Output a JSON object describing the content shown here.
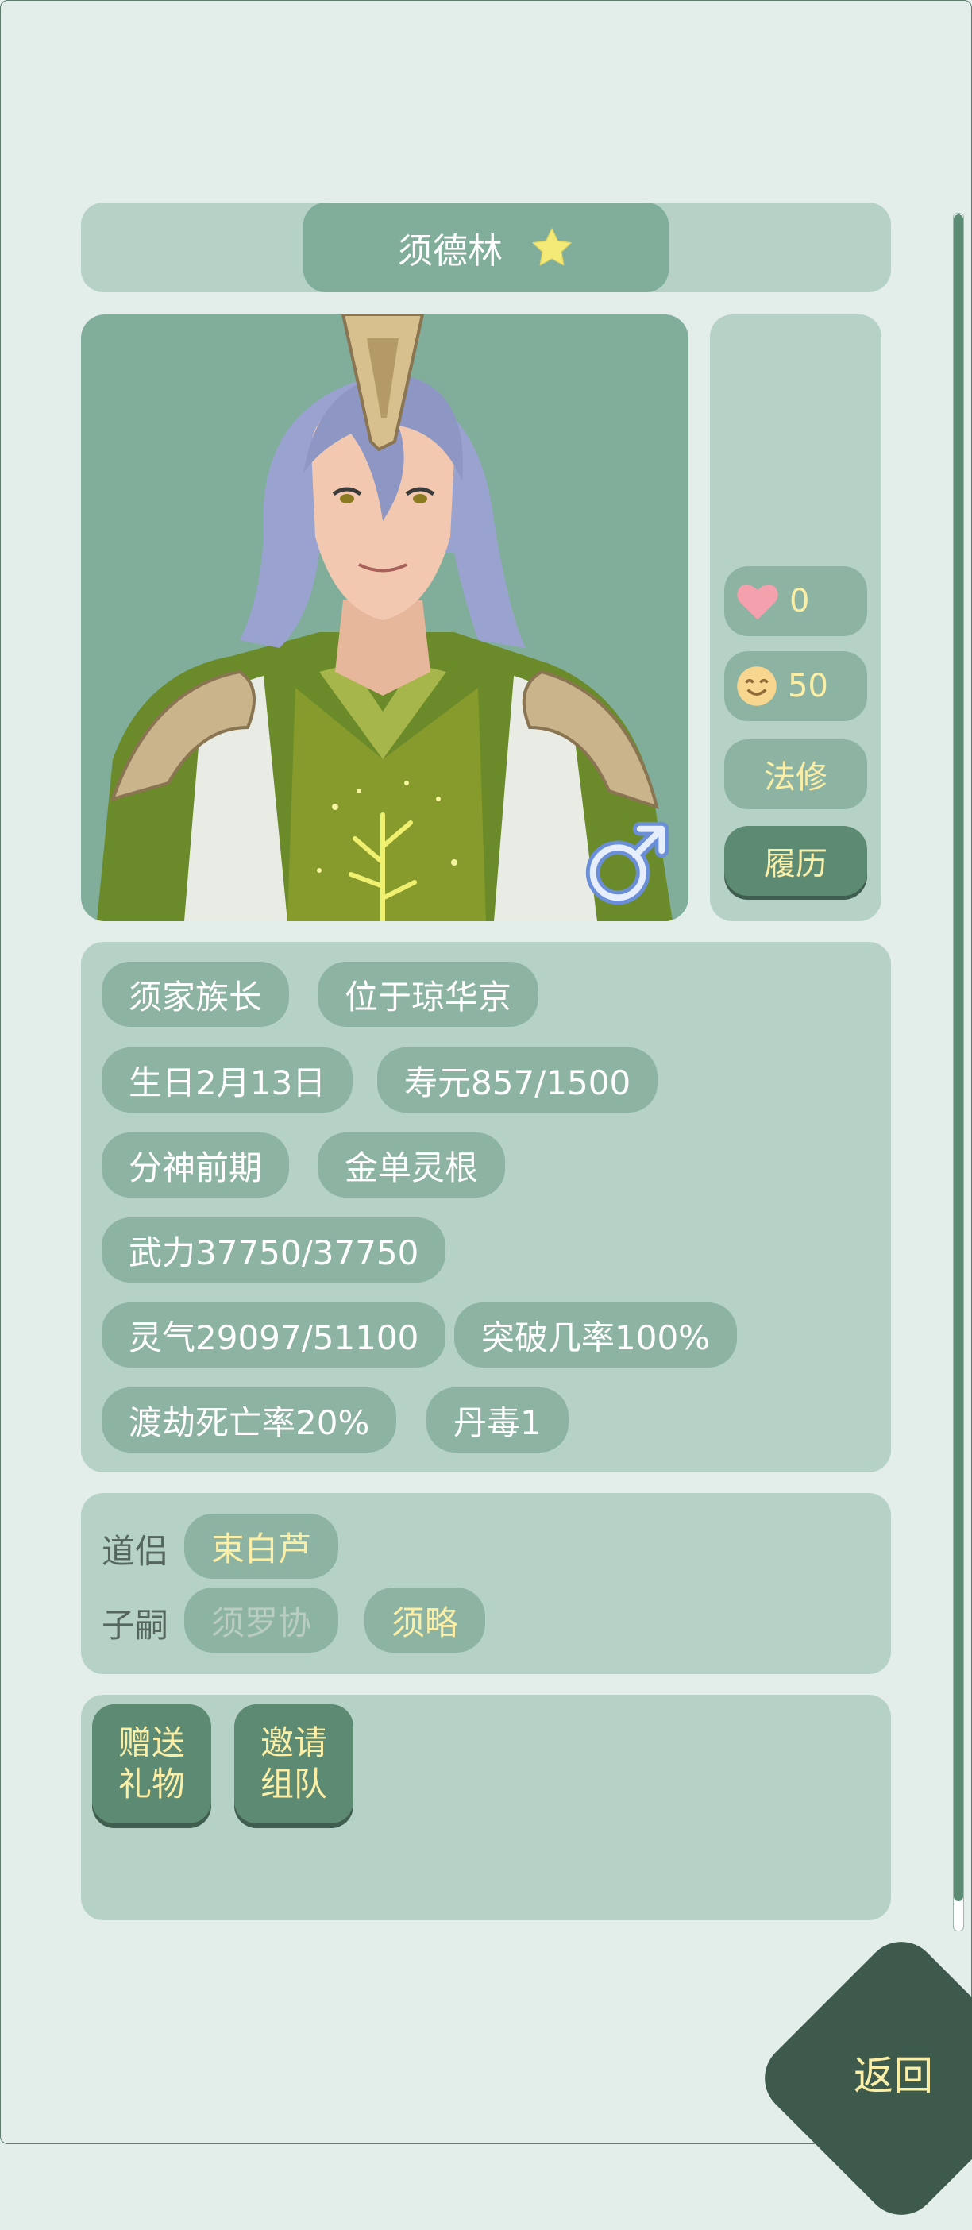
{
  "character": {
    "name": "须德林",
    "favorite_icon": "star-icon",
    "gender_icon": "male-icon"
  },
  "side": {
    "affection": "0",
    "mood": "50",
    "path_label": "法修",
    "history_label": "履历"
  },
  "info_tags": [
    "须家族长",
    "位于琼华京",
    "生日2月13日",
    "寿元857/1500",
    "分神前期",
    "金单灵根",
    "武力37750/37750",
    "灵气29097/51100",
    "突破几率100%",
    "渡劫死亡率20%",
    "丹毒1"
  ],
  "relations": {
    "partner_label": "道侣",
    "partner": "束白芦",
    "children_label": "子嗣",
    "children": [
      "须罗协",
      "须略"
    ]
  },
  "actions": {
    "gift_label": "赠送\n礼物",
    "invite_label": "邀请\n组队"
  },
  "nav": {
    "back_label": "返回"
  },
  "colors": {
    "background": "#e3eeea",
    "panel": "#b6d2c6",
    "pill": "#8db3a2",
    "dark_button": "#5c8a72",
    "gold_text": "#fbeea6",
    "back_button": "#3e5a4c"
  }
}
